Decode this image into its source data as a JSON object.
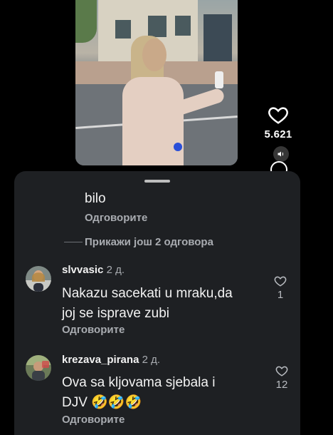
{
  "video": {
    "like_count": "5.621"
  },
  "comments": {
    "reply_fragment": {
      "text": "bilo",
      "reply_label": "Одговорите"
    },
    "more_replies_label": "Прикажи још 2 одговора",
    "items": [
      {
        "username": "slvvasic",
        "time": "2 д.",
        "text_line1": "Nakazu sacekati u mraku,da",
        "text_line2": "joj se isprave zubi",
        "reply_label": "Одговорите",
        "likes": "1"
      },
      {
        "username": "krezava_pirana",
        "time": "2 д.",
        "text_line1": "Ova sa kljovama sjebala i",
        "text_line2": "DJV 🤣🤣🤣",
        "reply_label": "Одговорите",
        "likes": "12"
      }
    ]
  },
  "colors": {
    "sheet_bg": "#1e2023",
    "secondary_text": "#a9acb1"
  },
  "icons": [
    "heart-icon",
    "speaker-icon",
    "heart-outline-icon"
  ]
}
